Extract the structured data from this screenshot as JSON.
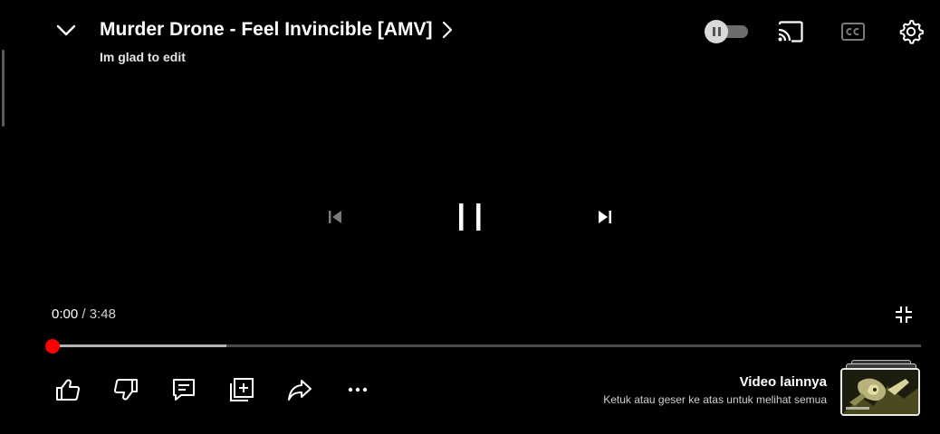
{
  "video": {
    "title": "Murder Drone - Feel Invincible [AMV]",
    "channel": "Im glad to edit"
  },
  "icons": {
    "collapse": "chevron-down-icon",
    "title_more": "chevron-right-icon",
    "autoplay": "autoplay-toggle-icon",
    "cast": "cast-icon",
    "captions": "closed-captions-icon",
    "settings": "gear-icon",
    "previous": "skip-previous-icon",
    "play_pause": "pause-icon",
    "next": "skip-next-icon",
    "exit_fullscreen": "exit-fullscreen-icon",
    "like": "thumbs-up-icon",
    "dislike": "thumbs-down-icon",
    "comments": "comment-icon",
    "save": "add-to-playlist-icon",
    "share": "share-icon",
    "more": "more-horizontal-icon"
  },
  "playback": {
    "current_time": "0:00",
    "separator": " / ",
    "duration": "3:48",
    "played_fraction": 0.0,
    "buffered_fraction": 0.2,
    "autoplay_on": false,
    "previous_enabled": false
  },
  "more_videos": {
    "title": "Video lainnya",
    "subtitle": "Ketuk atau geser ke atas untuk melihat semua"
  },
  "colors": {
    "background": "#000000",
    "progress_played": "#ff0000",
    "progress_buffered": "#b5b5b5",
    "progress_track": "#4a4a4a",
    "disabled_icon": "#7a7a7a"
  }
}
